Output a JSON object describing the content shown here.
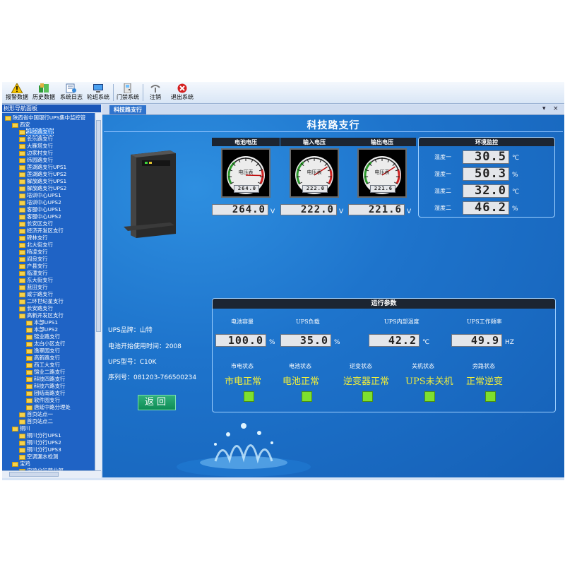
{
  "toolbar": [
    {
      "label": "报警数据",
      "icon": "warning-icon"
    },
    {
      "label": "历史数据",
      "icon": "history-data-icon"
    },
    {
      "label": "系统日志",
      "icon": "system-log-icon"
    },
    {
      "label": "轮班系统",
      "icon": "shift-system-icon"
    },
    {
      "label": "门禁系统",
      "icon": "door-access-icon"
    },
    {
      "label": "注销",
      "icon": "logout-icon"
    },
    {
      "label": "退出系统",
      "icon": "exit-icon"
    }
  ],
  "tree": {
    "title": "树形导航面板",
    "items": [
      {
        "label": "陕西省中国银行UPS集中监控管",
        "lvl": 0
      },
      {
        "label": "西安",
        "lvl": 1
      },
      {
        "label": "科技路支行",
        "lvl": 2,
        "sel": true
      },
      {
        "label": "长乐路支行",
        "lvl": 2
      },
      {
        "label": "大雁塔支行",
        "lvl": 2
      },
      {
        "label": "边家村支行",
        "lvl": 2
      },
      {
        "label": "纬园路支行",
        "lvl": 2
      },
      {
        "label": "莲湖路支行UPS1",
        "lvl": 2
      },
      {
        "label": "莲湖路支行UPS2",
        "lvl": 2
      },
      {
        "label": "解放路支行UPS1",
        "lvl": 2
      },
      {
        "label": "解放路支行UPS2",
        "lvl": 2
      },
      {
        "label": "培训中心UPS1",
        "lvl": 2
      },
      {
        "label": "培训中心UPS2",
        "lvl": 2
      },
      {
        "label": "客服中心UPS1",
        "lvl": 2
      },
      {
        "label": "客服中心UPS2",
        "lvl": 2
      },
      {
        "label": "长安区支行",
        "lvl": 2
      },
      {
        "label": "经济开发区支行",
        "lvl": 2
      },
      {
        "label": "碑林支行",
        "lvl": 2
      },
      {
        "label": "北大街支行",
        "lvl": 2
      },
      {
        "label": "杨凌支行",
        "lvl": 2
      },
      {
        "label": "阎良支行",
        "lvl": 2
      },
      {
        "label": "户县支行",
        "lvl": 2
      },
      {
        "label": "临潼支行",
        "lvl": 2
      },
      {
        "label": "东大街支行",
        "lvl": 2
      },
      {
        "label": "蓝田支行",
        "lvl": 2
      },
      {
        "label": "咸宁路支行",
        "lvl": 2
      },
      {
        "label": "二环世纪星支行",
        "lvl": 2
      },
      {
        "label": "长安路支行",
        "lvl": 2
      },
      {
        "label": "高新开发区支行",
        "lvl": 2
      },
      {
        "label": "本部UPS1",
        "lvl": 3
      },
      {
        "label": "本部UPS2",
        "lvl": 3
      },
      {
        "label": "锦业路支行",
        "lvl": 3
      },
      {
        "label": "太白小区支行",
        "lvl": 3
      },
      {
        "label": "逸翠园支行",
        "lvl": 3
      },
      {
        "label": "高新路支行",
        "lvl": 3
      },
      {
        "label": "西工大支行",
        "lvl": 3
      },
      {
        "label": "锦业二路支行",
        "lvl": 3
      },
      {
        "label": "科技四路支行",
        "lvl": 3
      },
      {
        "label": "科技六路支行",
        "lvl": 3
      },
      {
        "label": "团结南路支行",
        "lvl": 3
      },
      {
        "label": "软件园支行",
        "lvl": 3
      },
      {
        "label": "唐延中路分理处",
        "lvl": 3
      },
      {
        "label": "首页站点一",
        "lvl": 2
      },
      {
        "label": "首页站点二",
        "lvl": 2
      },
      {
        "label": "铜川",
        "lvl": 1
      },
      {
        "label": "铜川分行UPS1",
        "lvl": 2
      },
      {
        "label": "铜川分行UPS2",
        "lvl": 2
      },
      {
        "label": "铜川分行UPS3",
        "lvl": 2
      },
      {
        "label": "空调漏水检测",
        "lvl": 2
      },
      {
        "label": "宝鸡",
        "lvl": 1
      },
      {
        "label": "宝鸡分行营业部",
        "lvl": 2
      }
    ]
  },
  "tab": {
    "label": "科技路支行",
    "close": "×"
  },
  "main": {
    "title": "科技路支行",
    "gauges": [
      {
        "header": "电池电压",
        "dial_label": "电压表",
        "small": "264.0",
        "value": "264.0",
        "unit": "V",
        "reading": 264
      },
      {
        "header": "输入电压",
        "dial_label": "电压表",
        "small": "222.0",
        "value": "222.0",
        "unit": "V",
        "reading": 222
      },
      {
        "header": "输出电压",
        "dial_label": "电压表",
        "small": "221.6",
        "value": "221.6",
        "unit": "V",
        "reading": 221.6
      }
    ],
    "env": {
      "header": "环境监控",
      "rows": [
        {
          "label": "温度一",
          "value": "30.5",
          "unit": "℃"
        },
        {
          "label": "湿度一",
          "value": "50.3",
          "unit": "%"
        },
        {
          "label": "温度二",
          "value": "32.0",
          "unit": "℃"
        },
        {
          "label": "湿度二",
          "value": "46.2",
          "unit": "%"
        }
      ]
    },
    "info": {
      "brand": "UPS品牌：山特",
      "start": "电池开始使用时间：2008",
      "model": "UPS型号：C10K",
      "serial": "序列号：081203-766500234"
    },
    "back_button": "返回",
    "run": {
      "header": "运行参数",
      "params": [
        {
          "label": "电池容量",
          "value": "100.0",
          "unit": "%"
        },
        {
          "label": "UPS负载",
          "value": "35.0",
          "unit": "%"
        },
        {
          "label": "UPS内部温度",
          "value": "42.2",
          "unit": "℃"
        },
        {
          "label": "UPS工作频率",
          "value": "49.9",
          "unit": "HZ"
        }
      ],
      "statuses": [
        {
          "label": "市电状态",
          "value": "市电正常"
        },
        {
          "label": "电池状态",
          "value": "电池正常"
        },
        {
          "label": "逆变状态",
          "value": "逆变器正常"
        },
        {
          "label": "关机状态",
          "value": "UPS未关机"
        },
        {
          "label": "旁路状态",
          "value": "正常逆变"
        }
      ]
    }
  },
  "colors": {
    "led": "#7ee02e",
    "status_text": "#f2ef3a",
    "panel_bg": "#1e74cc"
  }
}
